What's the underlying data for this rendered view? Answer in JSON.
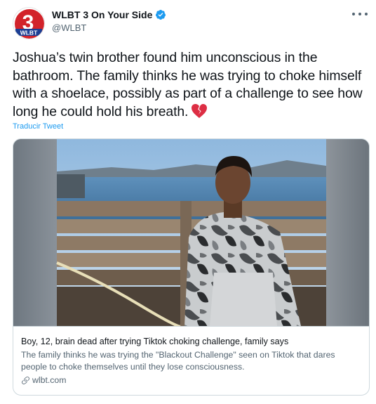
{
  "author": {
    "display_name": "WLBT 3 On Your Side",
    "handle": "@WLBT",
    "verified": true,
    "avatar_logo_text": "WLBT",
    "avatar_logo_number": "3",
    "brand_red": "#d2232a",
    "verified_color": "#1d9bf0"
  },
  "tweet": {
    "text": "Joshua’s twin brother found him unconscious in the bathroom. The family thinks he was trying to choke himself with a shoelace, possibly as part of a challenge to see how long he could hold his breath.",
    "emoji": "broken-heart-icon",
    "translate_label": "Traducir Tweet"
  },
  "card": {
    "title": "Boy, 12, brain dead after trying Tiktok choking challenge, family says",
    "description": "The family thinks he was trying the \"Blackout Challenge\" seen on Tiktok that dares people to choke themselves until they lose consciousness.",
    "domain": "wlbt.com",
    "image_subject": "boy-in-camo-hoodie-photo"
  },
  "colors": {
    "link_blue": "#1d9bf0",
    "secondary_text": "#536471",
    "border": "#cfd9de"
  }
}
